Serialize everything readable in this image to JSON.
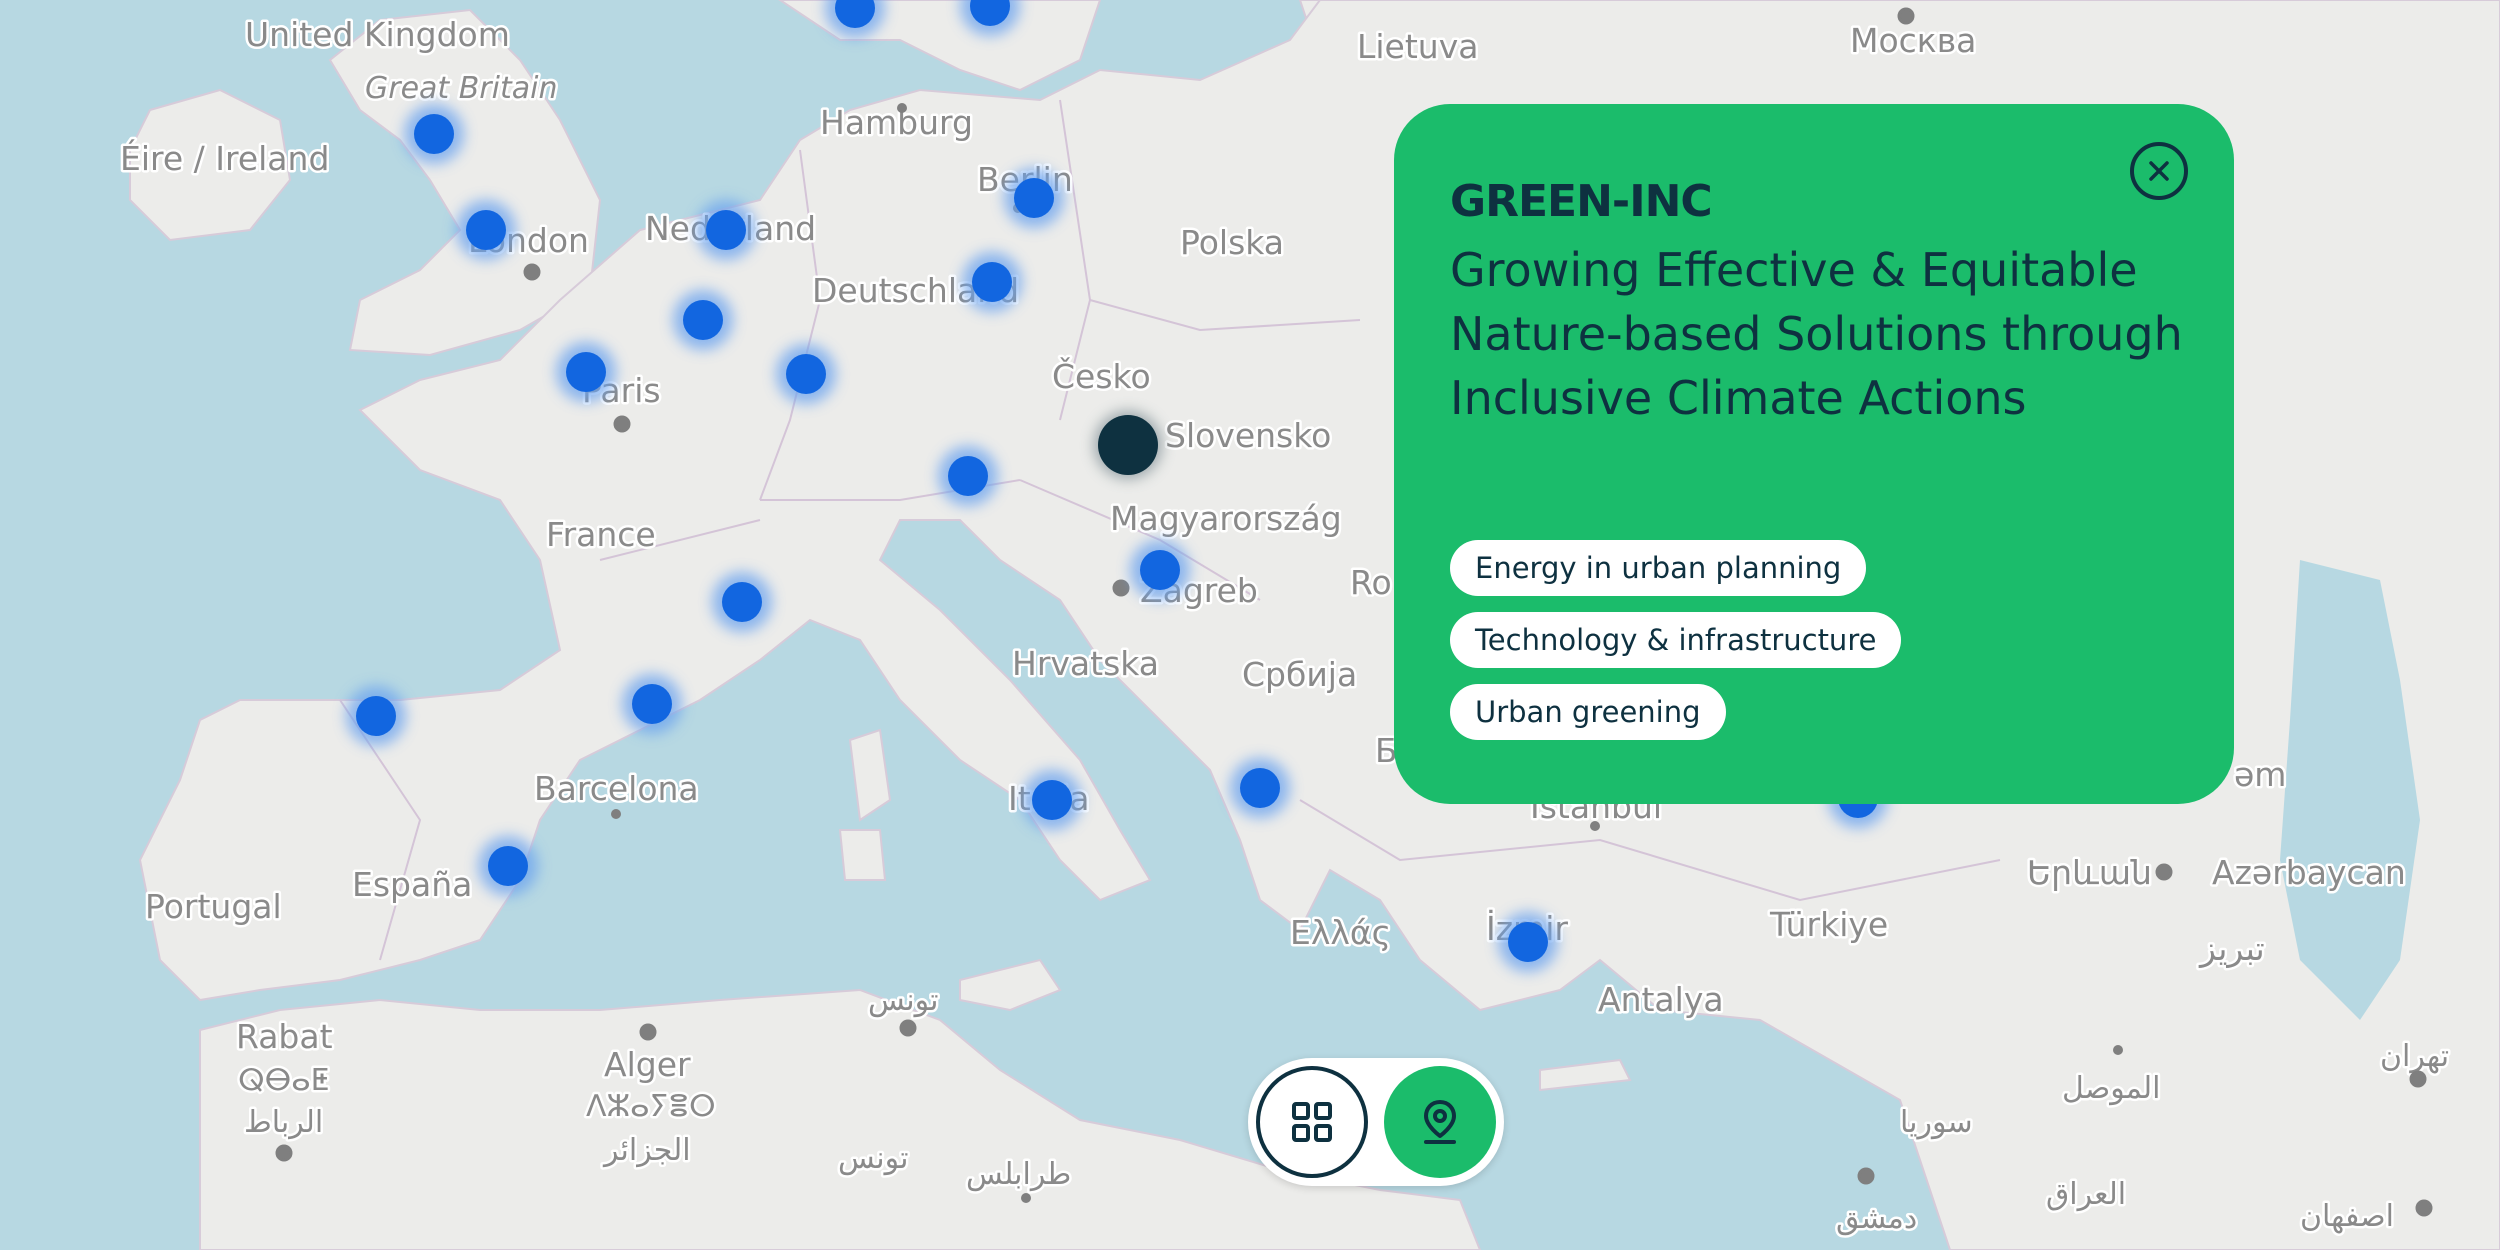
{
  "colors": {
    "accent": "#1bbc6b",
    "text_dark": "#0e3140",
    "marker_blue": "#1266e0",
    "marker_selected": "#0e3140",
    "water": "#b7d8e2",
    "land": "#ececea"
  },
  "map": {
    "labels": {
      "united_kingdom": "United Kingdom",
      "great_britain": "Great Britain",
      "ireland": "Éire / Ireland",
      "london": "London",
      "nederland": "Nederland",
      "hamburg": "Hamburg",
      "berlin": "Berlin",
      "deutschland": "Deutschland",
      "lietuva": "Lietuva",
      "moskva": "Москва",
      "polska": "Polska",
      "cesko": "Česko",
      "slovensko": "Slovensko",
      "magyarorszag": "Magyarország",
      "paris": "Paris",
      "france": "France",
      "zagreb": "Zagreb",
      "hrvatska": "Hrvatska",
      "srbija": "Србија",
      "ro": "Ro",
      "barcelona": "Barcelona",
      "italia": "Italia",
      "istanbul": "İstanbul",
      "yerevan": "Երևան",
      "azerbaycan": "Azərbaycan",
      "espana": "España",
      "portugal": "Portugal",
      "ellada": "Ελλάς",
      "izmir": "İzmir",
      "turkiye": "Türkiye",
      "tabriz": "تبریز",
      "antalya": "Antalya",
      "tunis_ar": "تونس",
      "tunis_ar2": "تونس",
      "rabat": "Rabat",
      "rabat_tif": "ⵕⴱⴰⵟ",
      "rabat_ar": "الرباط",
      "alger": "Alger",
      "alger_tif": "ⴷⵣⴰⵢⴻⵔ",
      "alger_ar": "الجزائر",
      "tarabulus": "طرابلس",
      "mosul": "الموصل",
      "tehran": "تهران",
      "suriya": "سوريا",
      "iraq": "العراق",
      "dimashq": "دمشق",
      "esfahan": "اصفهان",
      "b_partial": "Б",
      "am_partial": "əm"
    }
  },
  "card": {
    "title": "GREEN-INC",
    "description": "Growing Effective & Equitable Nature-based Solutions through Inclusive Climate Actions",
    "close_icon": "close-icon",
    "tags": [
      "Energy in urban planning",
      "Technology & infrastructure",
      "Urban greening"
    ]
  },
  "view_toggle": {
    "grid_icon": "grid-icon",
    "map_icon": "map-pin-icon",
    "active": "map"
  }
}
